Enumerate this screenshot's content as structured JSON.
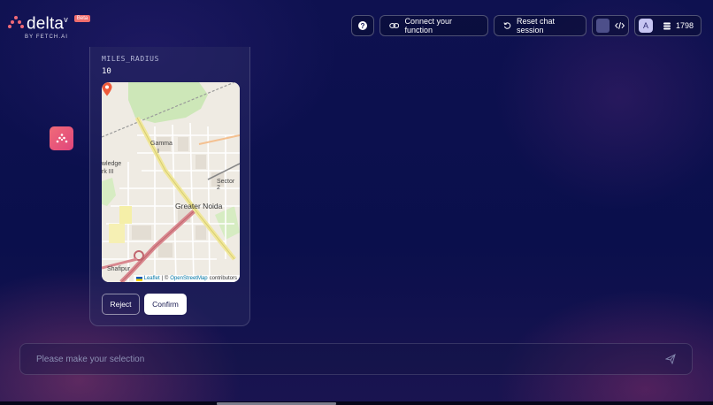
{
  "brand": {
    "name": "delta",
    "superscript": "v",
    "badge": "Beta",
    "byline": "BY FETCH.AI"
  },
  "header": {
    "help_icon": "question-circle-icon",
    "connect_label": "Connect your function",
    "connect_icon": "link-icon",
    "reset_label": "Reset chat session",
    "reset_icon": "rotate-ccw-icon",
    "dev_icon": "code-icon",
    "avatar_initial": "A",
    "credits_icon": "coins-stack-icon",
    "credits": "1798"
  },
  "card": {
    "field_label": "MILES_RADIUS",
    "field_value": "10",
    "map": {
      "labels": [
        "Gamma",
        "I",
        "wledge",
        "rk III",
        "Sector 2",
        "Shafipur"
      ],
      "city": "Greater Noida",
      "attribution_link1": "Leaflet",
      "attribution_sep": "| ©",
      "attribution_link2": "OpenStreetMap",
      "attribution_tail": "contributors"
    },
    "reject_label": "Reject",
    "confirm_label": "Confirm"
  },
  "chat": {
    "placeholder": "Please make your selection",
    "send_icon": "send-icon"
  },
  "colors": {
    "background": "#0b0e4a",
    "accent": "#f06b78",
    "pin": "#ef5a3b"
  }
}
